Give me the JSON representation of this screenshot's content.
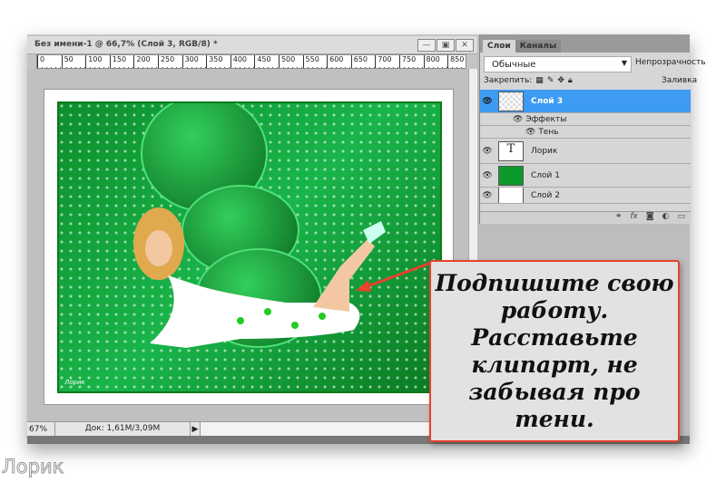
{
  "document": {
    "title": "Без имени-1 @ 66,7% (Слой 3, RGB/8) *",
    "window_buttons": [
      "—",
      "▣",
      "✕"
    ],
    "ruler_ticks": [
      "0",
      "50",
      "100",
      "150",
      "200",
      "250",
      "300",
      "350",
      "400",
      "450",
      "500",
      "550",
      "600",
      "650",
      "700",
      "750",
      "800",
      "850"
    ],
    "signature": "Лорик",
    "status": {
      "zoom": "67%",
      "doc_size": "Док: 1,61M/3,09M"
    }
  },
  "panel": {
    "tabs": [
      "Слои",
      "Каналы"
    ],
    "blend_mode": "Обычные",
    "opacity_label": "Непрозрачность",
    "lock_label": "Закрепить:",
    "fill_label": "Заливка",
    "layers": [
      {
        "name": "Слой 3",
        "selected": true
      },
      {
        "name": "Лорик",
        "thumb": "T"
      },
      {
        "name": "Слой 1"
      },
      {
        "name": "Слой 2"
      }
    ],
    "effects_label": "Эффекты",
    "shadow_label": "Тень"
  },
  "callout": {
    "text": "Подпишите свою работу. Расставьте клипарт, не забывая про тени.",
    "border_color": "#e8412c"
  },
  "watermark": "Лорик"
}
